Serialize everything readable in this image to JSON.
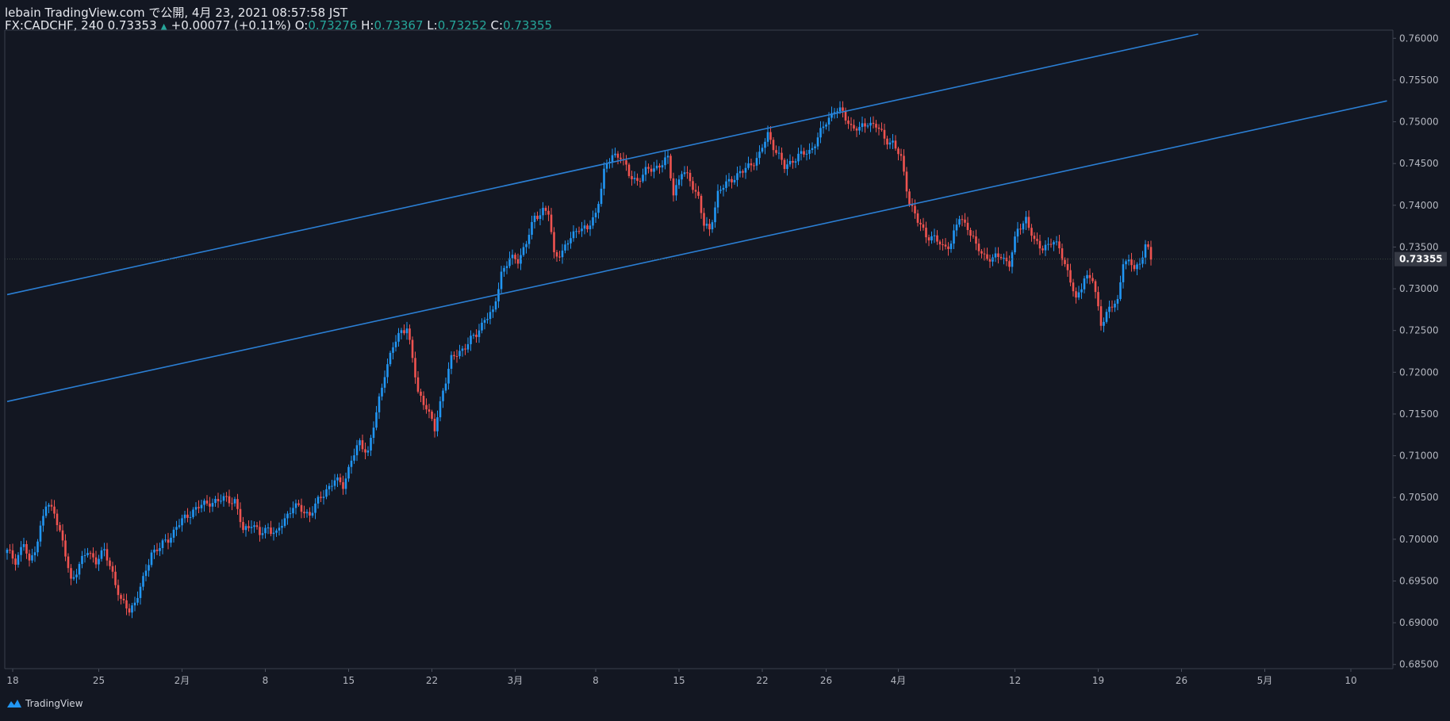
{
  "header": {
    "published_line": "lebain TradingView.com で公開, 4月 23, 2021 08:57:58 JST",
    "symbol_line": "FX:CADCHF, 240",
    "last": "0.73353",
    "change": "+0.00077 (+0.11%)",
    "o_label": "O:",
    "o_value": "0.73276",
    "h_label": "H:",
    "h_value": "0.73367",
    "l_label": "L:",
    "l_value": "0.73252",
    "c_label": "C:",
    "c_value": "0.73355"
  },
  "footer": {
    "brand": "TradingView"
  },
  "colors": {
    "background": "#131722",
    "up": "#2196f3",
    "down": "#ef5350",
    "trendline": "#2b7fd4",
    "axis_text": "#b2b5be",
    "price_tag": "#363a45"
  },
  "chart_data": {
    "type": "candlestick",
    "symbol": "FX:CADCHF",
    "interval": "240",
    "ylim": [
      0.6845,
      0.7605
    ],
    "y_ticks": [
      "0.76000",
      "0.75500",
      "0.75000",
      "0.74500",
      "0.74000",
      "0.73500",
      "0.73000",
      "0.72500",
      "0.72000",
      "0.71500",
      "0.71000",
      "0.70500",
      "0.70000",
      "0.69500",
      "0.69000",
      "0.68500"
    ],
    "x_ticks": [
      "18",
      "25",
      "2月",
      "8",
      "15",
      "22",
      "3月",
      "8",
      "15",
      "22",
      "26",
      "4月",
      "12",
      "19",
      "26",
      "5月",
      "10"
    ],
    "last_price_label": "0.73355",
    "price_path": [
      [
        0,
        0.6985
      ],
      [
        3,
        0.6975
      ],
      [
        6,
        0.6995
      ],
      [
        8,
        0.697
      ],
      [
        11,
        0.7
      ],
      [
        14,
        0.704
      ],
      [
        17,
        0.7035
      ],
      [
        20,
        0.6995
      ],
      [
        23,
        0.695
      ],
      [
        26,
        0.697
      ],
      [
        29,
        0.6985
      ],
      [
        32,
        0.6975
      ],
      [
        35,
        0.6985
      ],
      [
        38,
        0.696
      ],
      [
        41,
        0.6925
      ],
      [
        44,
        0.6915
      ],
      [
        46,
        0.6925
      ],
      [
        49,
        0.695
      ],
      [
        52,
        0.6985
      ],
      [
        55,
        0.699
      ],
      [
        58,
        0.7
      ],
      [
        61,
        0.7015
      ],
      [
        64,
        0.7025
      ],
      [
        67,
        0.7035
      ],
      [
        70,
        0.704
      ],
      [
        73,
        0.7045
      ],
      [
        76,
        0.7045
      ],
      [
        79,
        0.705
      ],
      [
        82,
        0.7045
      ],
      [
        85,
        0.701
      ],
      [
        88,
        0.702
      ],
      [
        91,
        0.7005
      ],
      [
        94,
        0.7015
      ],
      [
        97,
        0.7005
      ],
      [
        100,
        0.7025
      ],
      [
        103,
        0.704
      ],
      [
        106,
        0.7035
      ],
      [
        109,
        0.703
      ],
      [
        112,
        0.7045
      ],
      [
        115,
        0.706
      ],
      [
        118,
        0.707
      ],
      [
        121,
        0.7065
      ],
      [
        124,
        0.7095
      ],
      [
        127,
        0.7115
      ],
      [
        130,
        0.7105
      ],
      [
        133,
        0.715
      ],
      [
        136,
        0.72
      ],
      [
        139,
        0.723
      ],
      [
        142,
        0.725
      ],
      [
        144,
        0.7255
      ],
      [
        146,
        0.7215
      ],
      [
        148,
        0.7175
      ],
      [
        151,
        0.716
      ],
      [
        154,
        0.713
      ],
      [
        157,
        0.718
      ],
      [
        160,
        0.7215
      ],
      [
        163,
        0.7225
      ],
      [
        166,
        0.7235
      ],
      [
        169,
        0.7245
      ],
      [
        172,
        0.7265
      ],
      [
        175,
        0.727
      ],
      [
        178,
        0.732
      ],
      [
        181,
        0.7335
      ],
      [
        184,
        0.7335
      ],
      [
        187,
        0.7355
      ],
      [
        190,
        0.7385
      ],
      [
        193,
        0.7395
      ],
      [
        195,
        0.739
      ],
      [
        197,
        0.734
      ],
      [
        200,
        0.7345
      ],
      [
        203,
        0.736
      ],
      [
        206,
        0.7375
      ],
      [
        209,
        0.737
      ],
      [
        212,
        0.739
      ],
      [
        215,
        0.744
      ],
      [
        218,
        0.746
      ],
      [
        221,
        0.746
      ],
      [
        224,
        0.7435
      ],
      [
        227,
        0.743
      ],
      [
        230,
        0.744
      ],
      [
        233,
        0.7445
      ],
      [
        236,
        0.745
      ],
      [
        238,
        0.7455
      ],
      [
        240,
        0.7415
      ],
      [
        243,
        0.744
      ],
      [
        246,
        0.743
      ],
      [
        249,
        0.741
      ],
      [
        251,
        0.7375
      ],
      [
        253,
        0.737
      ],
      [
        256,
        0.7415
      ],
      [
        259,
        0.7425
      ],
      [
        262,
        0.7435
      ],
      [
        265,
        0.744
      ],
      [
        268,
        0.745
      ],
      [
        271,
        0.746
      ],
      [
        274,
        0.7485
      ],
      [
        277,
        0.7465
      ],
      [
        280,
        0.7445
      ],
      [
        283,
        0.7455
      ],
      [
        286,
        0.746
      ],
      [
        289,
        0.7465
      ],
      [
        292,
        0.748
      ],
      [
        295,
        0.75
      ],
      [
        298,
        0.7515
      ],
      [
        301,
        0.751
      ],
      [
        304,
        0.7495
      ],
      [
        307,
        0.749
      ],
      [
        310,
        0.75
      ],
      [
        313,
        0.7495
      ],
      [
        316,
        0.748
      ],
      [
        319,
        0.7475
      ],
      [
        322,
        0.7455
      ],
      [
        325,
        0.7405
      ],
      [
        328,
        0.738
      ],
      [
        331,
        0.7365
      ],
      [
        334,
        0.736
      ],
      [
        337,
        0.735
      ],
      [
        340,
        0.7355
      ],
      [
        343,
        0.7385
      ],
      [
        346,
        0.7375
      ],
      [
        349,
        0.735
      ],
      [
        352,
        0.734
      ],
      [
        355,
        0.7335
      ],
      [
        358,
        0.734
      ],
      [
        361,
        0.733
      ],
      [
        364,
        0.737
      ],
      [
        367,
        0.7385
      ],
      [
        370,
        0.7355
      ],
      [
        373,
        0.735
      ],
      [
        376,
        0.7355
      ],
      [
        379,
        0.735
      ],
      [
        382,
        0.732
      ],
      [
        385,
        0.7285
      ],
      [
        388,
        0.7315
      ],
      [
        391,
        0.731
      ],
      [
        394,
        0.726
      ],
      [
        397,
        0.7275
      ],
      [
        400,
        0.7285
      ],
      [
        402,
        0.7335
      ],
      [
        404,
        0.733
      ],
      [
        406,
        0.7325
      ],
      [
        408,
        0.733
      ],
      [
        410,
        0.7355
      ],
      [
        412,
        0.7335
      ]
    ],
    "trendlines": [
      {
        "from": [
          0,
          0.7293
        ],
        "to": [
          429,
          0.7605
        ]
      },
      {
        "from": [
          0,
          0.7165
        ],
        "to": [
          497,
          0.7525
        ]
      }
    ],
    "x_tick_bars": [
      2,
      33,
      63,
      93,
      123,
      153,
      183,
      212,
      242,
      272,
      295,
      321,
      363,
      393,
      423,
      453,
      484
    ]
  }
}
